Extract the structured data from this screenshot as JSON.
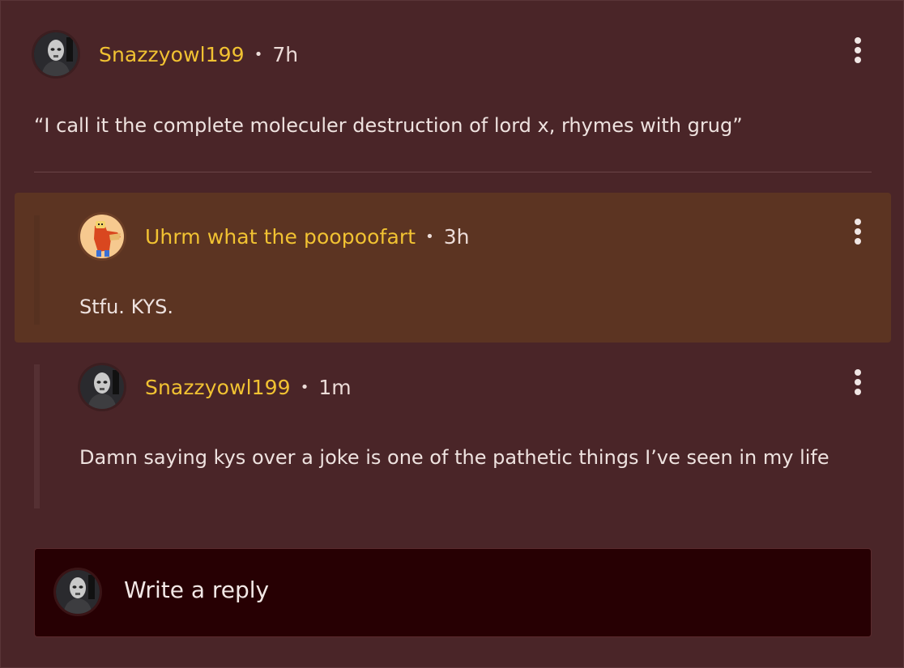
{
  "comment": {
    "username": "Snazzyowl199",
    "separator": "•",
    "time": "7h",
    "text": "“I call it the complete moleculer destruction of lord x, rhymes with grug”",
    "avatar_icon": "masked-figure-avatar"
  },
  "replies": [
    {
      "username": "Uhrm what the poopoofart",
      "separator": "•",
      "time": "3h",
      "text": "Stfu. KYS.",
      "highlighted": true,
      "avatar_icon": "cartoon-character-avatar"
    },
    {
      "username": "Snazzyowl199",
      "separator": "•",
      "time": "1m",
      "text": "Damn saying kys over a joke is one of the pathetic things I’ve seen in my life",
      "highlighted": false,
      "avatar_icon": "masked-figure-avatar"
    }
  ],
  "reply_box": {
    "placeholder": "Write a reply",
    "avatar_icon": "masked-figure-avatar"
  },
  "colors": {
    "background": "#4a2528",
    "highlight": "#5c3422",
    "username": "#f1c232",
    "text": "#eee2df",
    "reply_box": "#270003"
  }
}
